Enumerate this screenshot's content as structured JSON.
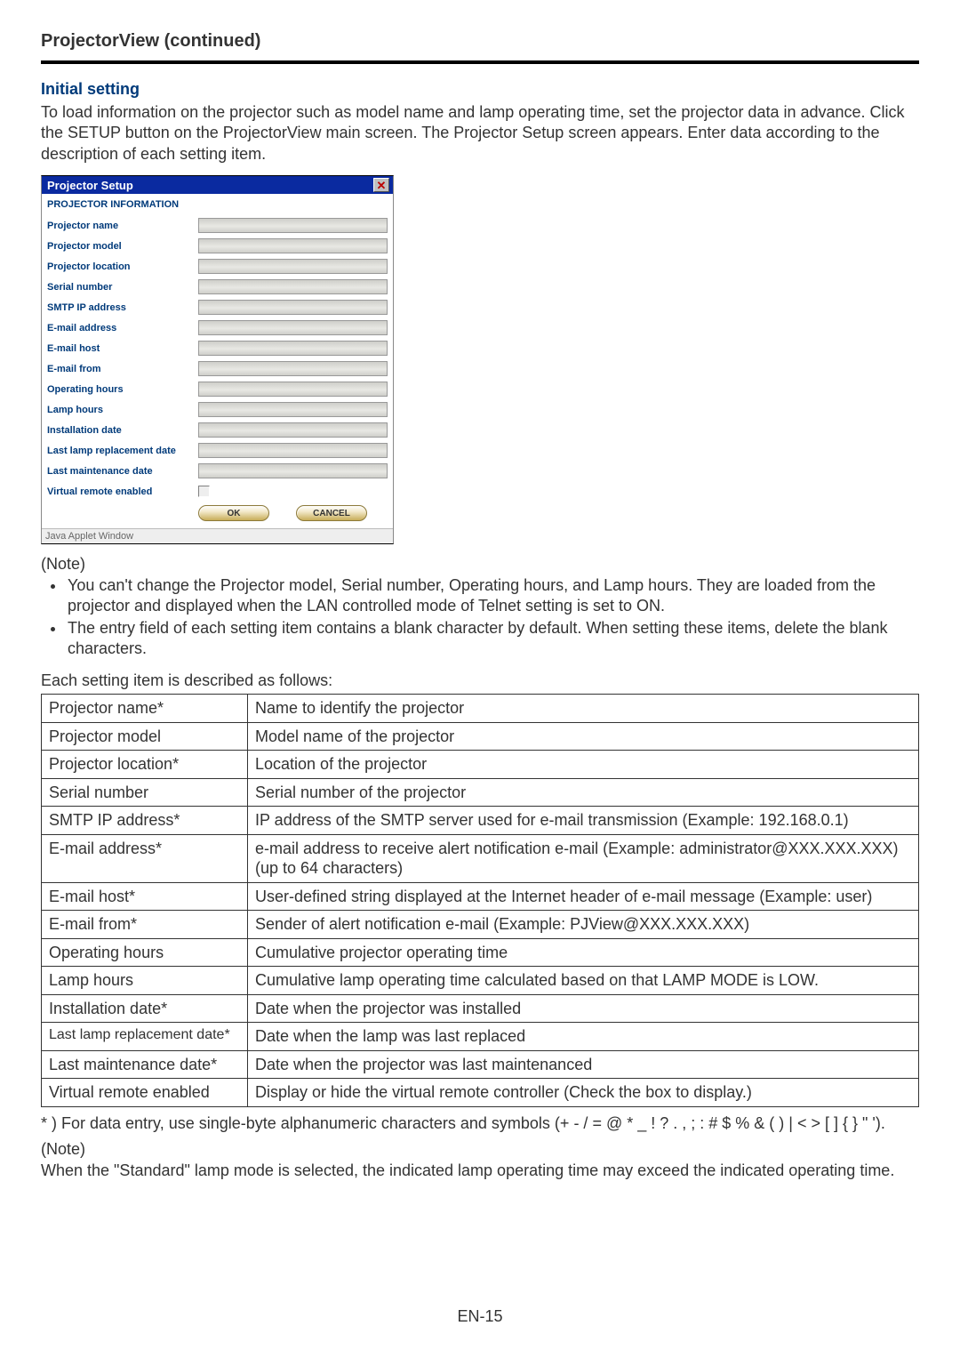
{
  "header": {
    "title": "ProjectorView (continued)"
  },
  "section": {
    "heading": "Initial setting",
    "intro": "To load information on the projector such as model name and lamp operating time, set the projector data in advance. Click the SETUP button on the ProjectorView main screen. The Projector Setup screen appears. Enter data according to the description of each setting item."
  },
  "dialog": {
    "title": "Projector Setup",
    "section_label": "PROJECTOR INFORMATION",
    "labels": {
      "projector_name": "Projector name",
      "projector_model": "Projector model",
      "projector_location": "Projector location",
      "serial_number": "Serial number",
      "smtp_ip": "SMTP IP address",
      "email_address": "E-mail address",
      "email_host": "E-mail host",
      "email_from": "E-mail from",
      "operating_hours": "Operating hours",
      "lamp_hours": "Lamp hours",
      "installation_date": "Installation date",
      "last_lamp_replace": "Last lamp replacement date",
      "last_maintenance": "Last maintenance date",
      "virtual_remote": "Virtual remote enabled"
    },
    "buttons": {
      "ok": "OK",
      "cancel": "CANCEL"
    },
    "status": "Java Applet Window"
  },
  "note1": {
    "heading": "(Note)",
    "items": [
      "You can't change the Projector model, Serial number, Operating hours, and Lamp hours. They are loaded from the projector and displayed when the LAN controlled mode of Telnet setting is set to ON.",
      "The entry field of each setting item contains a blank character by default. When setting these items, delete the blank characters."
    ]
  },
  "table_intro": "Each setting item is described as follows:",
  "settings": [
    {
      "name": "Projector name*",
      "desc": "Name to identify the projector"
    },
    {
      "name": "Projector model",
      "desc": "Model name of the projector"
    },
    {
      "name": "Projector location*",
      "desc": "Location of the projector"
    },
    {
      "name": "Serial number",
      "desc": "Serial number of the projector"
    },
    {
      "name": "SMTP IP address*",
      "desc": "IP address of the SMTP server used for e-mail transmission (Example: 192.168.0.1)"
    },
    {
      "name": "E-mail address*",
      "desc": "e-mail address to receive alert notification e-mail (Example: administrator@XXX.XXX.XXX) (up to 64 characters)"
    },
    {
      "name": "E-mail host*",
      "desc": "User-defined string displayed at the Internet header of e-mail message (Example: user)"
    },
    {
      "name": "E-mail from*",
      "desc": "Sender of alert notification e-mail (Example: PJView@XXX.XXX.XXX)"
    },
    {
      "name": "Operating hours",
      "desc": "Cumulative projector operating time"
    },
    {
      "name": "Lamp hours",
      "desc": "Cumulative lamp operating time calculated based on that LAMP MODE is LOW."
    },
    {
      "name": "Installation date*",
      "desc": "Date when the projector was installed"
    },
    {
      "name": "Last lamp replacement date*",
      "desc": "Date when the lamp was last replaced",
      "small": true
    },
    {
      "name": "Last maintenance date*",
      "desc": "Date when the projector was last maintenanced"
    },
    {
      "name": "Virtual remote enabled",
      "desc": "Display or hide the virtual remote controller (Check the box to display.)"
    }
  ],
  "footnote": "* ) For data entry, use single-byte alphanumeric characters and symbols (+ - / = @ * _ ! ? . , ; : # $ % & ( ) | < > [ ] { } \" ').",
  "note2": {
    "heading": "(Note)",
    "text": "When the \"Standard\" lamp mode is selected, the indicated lamp operating time may exceed the indicated operating time."
  },
  "page_number": "EN-15"
}
